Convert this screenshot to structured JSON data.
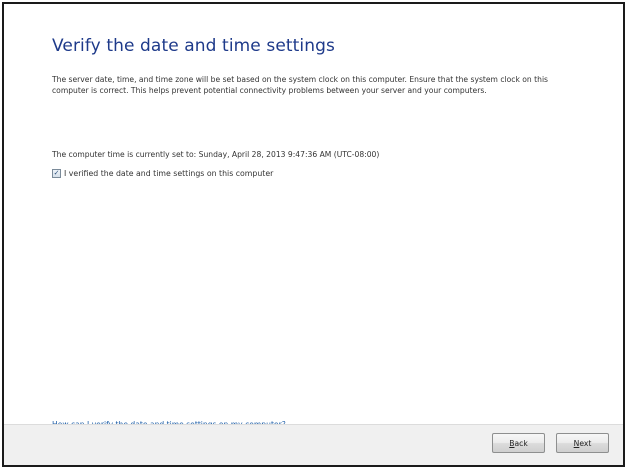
{
  "page": {
    "title": "Verify the date and time settings",
    "description": "The server date, time, and time zone will be set based on the system clock on this computer. Ensure that the system clock on this computer is correct. This helps prevent potential connectivity problems between your server and your computers.",
    "time_text": "The computer time is currently set to: Sunday, April 28, 2013 9:47:36 AM (UTC-08:00)"
  },
  "checkbox": {
    "label": "I verified the date and time settings on this computer",
    "checked": true,
    "checkmark_glyph": "✓"
  },
  "help_link": {
    "text": "How can I verify the date and time settings on my computer?"
  },
  "footer": {
    "back_label_accel": "B",
    "back_label_rest": "ack",
    "next_label_accel": "N",
    "next_label_rest": "ext"
  },
  "colors": {
    "title": "#1e3a8a",
    "link": "#1f5fa8",
    "footer_bg": "#f0f0f0",
    "text": "#333333"
  }
}
